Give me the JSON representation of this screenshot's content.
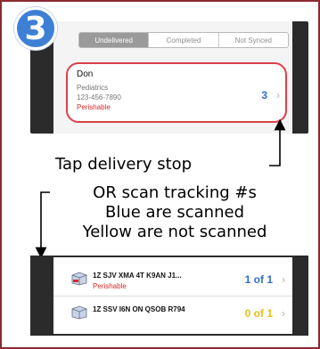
{
  "step": {
    "number": "3"
  },
  "tabs": [
    {
      "label": "Undelivered",
      "active": true
    },
    {
      "label": "Completed",
      "active": false
    },
    {
      "label": "Not Synced",
      "active": false
    }
  ],
  "stop": {
    "name": "Don",
    "department": "Pediatrics",
    "phone": "123-456-7890",
    "flag": "Perishable",
    "count": "3",
    "chevron": "›"
  },
  "annotations": {
    "tap": "Tap delivery stop",
    "scan_line1": "OR scan tracking #s",
    "scan_line2": "Blue are scanned",
    "scan_line3": "Yellow are not scanned"
  },
  "packages": [
    {
      "tracking": "1Z SJV XMA 4T K9AN J1...",
      "flag": "Perishable",
      "count": "1 of 1",
      "status_color": "#2f6fd0",
      "chevron": "›"
    },
    {
      "tracking": "1Z SSV I6N ON QSOB R794",
      "flag": "",
      "count": "0 of 1",
      "status_color": "#e8c314",
      "chevron": "›"
    }
  ],
  "colors": {
    "accent_blue": "#3e7fd6",
    "highlight_red": "#d9414a",
    "scanned_blue": "#2f6fd0",
    "unscanned_yellow": "#e8c314",
    "frame": "#8a2a32"
  }
}
